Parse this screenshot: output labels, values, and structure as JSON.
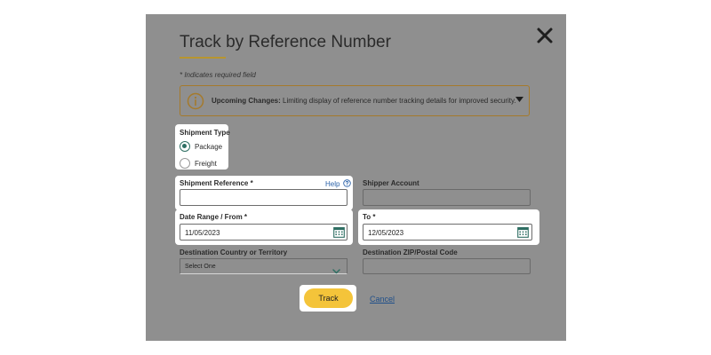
{
  "dialog": {
    "title": "Track by Reference Number",
    "required_note": "* Indicates required field"
  },
  "notice": {
    "heading": "Upcoming Changes:",
    "text": " Limiting display of reference number tracking details for improved security."
  },
  "shipment_type": {
    "label": "Shipment Type",
    "options": [
      {
        "label": "Package",
        "selected": true
      },
      {
        "label": "Freight",
        "selected": false
      }
    ]
  },
  "shipment_reference": {
    "label": "Shipment Reference *",
    "value": "",
    "help_label": "Help"
  },
  "shipper_account": {
    "label": "Shipper Account",
    "value": ""
  },
  "date_from": {
    "label": "Date Range / From *",
    "value": "11/05/2023"
  },
  "date_to": {
    "label": "To *",
    "value": "12/05/2023"
  },
  "destination_country": {
    "label": "Destination Country or Territory",
    "selected": "Select One"
  },
  "destination_zip": {
    "label": "Destination ZIP/Postal Code",
    "value": ""
  },
  "actions": {
    "track_label": "Track",
    "cancel_label": "Cancel"
  },
  "colors": {
    "overlay": "#8f8f8f",
    "accent_gold": "#b8952f",
    "notice_border": "#a57a2c",
    "radio_selected": "#2f6f63",
    "calendar_icon": "#2f6f63",
    "link": "#2a61a8",
    "track_button": "#f4c43a"
  },
  "icons": {
    "close": "close-icon",
    "info": "info-icon",
    "calendar": "calendar-icon",
    "help": "help-circle-icon",
    "chevron": "chevron-down-icon"
  }
}
